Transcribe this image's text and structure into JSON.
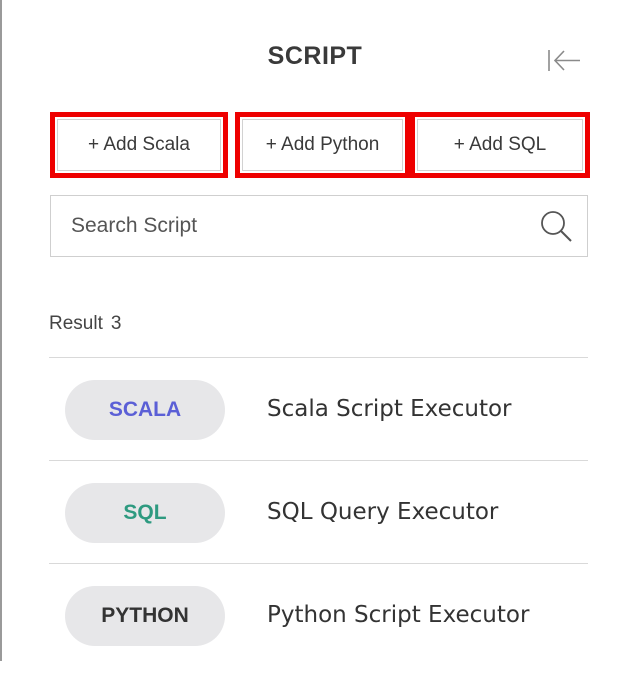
{
  "panel": {
    "title": "SCRIPT",
    "collapse_icon": "collapse-left-icon"
  },
  "add_buttons": [
    {
      "label": "+ Add Scala"
    },
    {
      "label": "+ Add Python"
    },
    {
      "label": "+ Add SQL"
    }
  ],
  "search": {
    "placeholder": "Search Script",
    "value": "",
    "icon": "search-icon"
  },
  "result": {
    "label": "Result",
    "count": "3"
  },
  "scripts": [
    {
      "badge": "SCALA",
      "badge_color": "#5b5fd6",
      "name": "Scala Script Executor"
    },
    {
      "badge": "SQL",
      "badge_color": "#2e9a80",
      "name": "SQL Query Executor"
    },
    {
      "badge": "PYTHON",
      "badge_color": "#333333",
      "name": "Python Script Executor"
    }
  ],
  "colors": {
    "highlight_border": "#ee0000",
    "badge_background": "#e7e7e9"
  }
}
